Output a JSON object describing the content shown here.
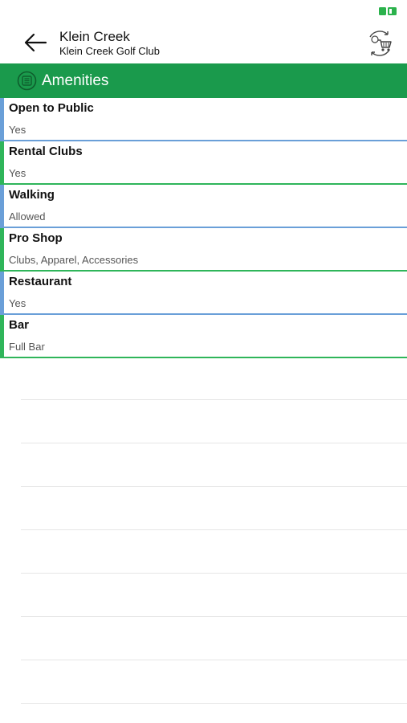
{
  "header": {
    "title": "Klein Creek",
    "subtitle": "Klein Creek Golf Club"
  },
  "section": {
    "title": "Amenities"
  },
  "amenities": [
    {
      "label": "Open to Public",
      "value": "Yes"
    },
    {
      "label": "Rental Clubs",
      "value": "Yes"
    },
    {
      "label": "Walking",
      "value": "Allowed"
    },
    {
      "label": "Pro Shop",
      "value": "Clubs, Apparel, Accessories"
    },
    {
      "label": "Restaurant",
      "value": "Yes"
    },
    {
      "label": "Bar",
      "value": "Full Bar"
    }
  ],
  "icons": {
    "back": "back-arrow-icon",
    "cart": "shopping-cart-icon",
    "section": "amenities-icon",
    "battery": "battery-icon"
  },
  "colors": {
    "accent_green": "#1a9a4c",
    "row_blue": "#6a9fd8",
    "row_green": "#2fb55a",
    "battery_green": "#2bb24c"
  }
}
